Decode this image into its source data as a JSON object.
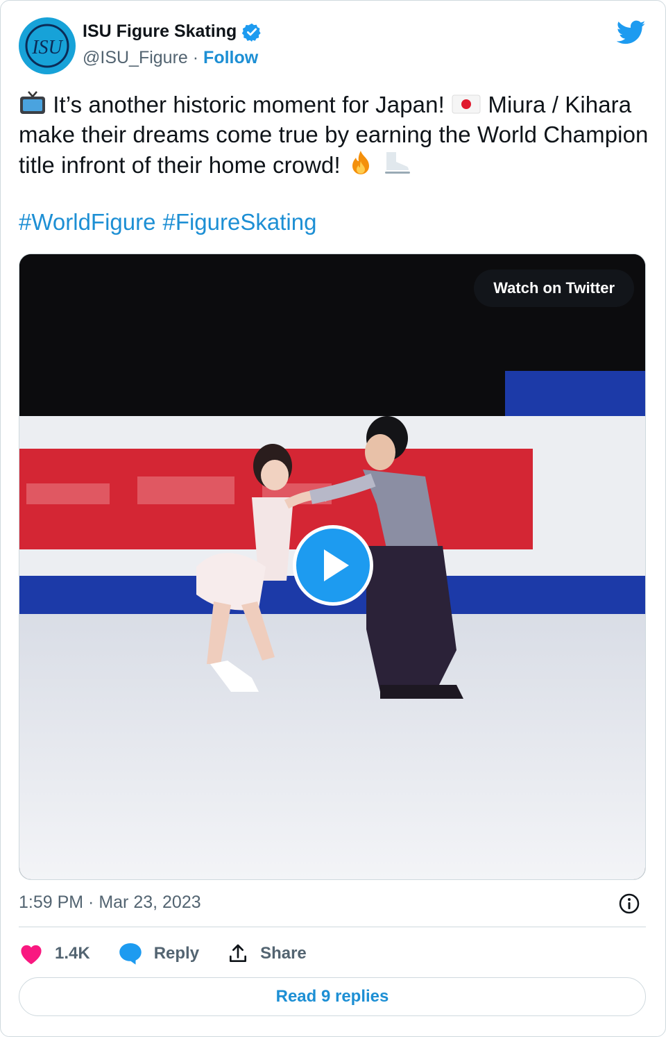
{
  "author": {
    "display_name": "ISU Figure Skating",
    "handle": "@ISU_Figure",
    "separator": " · ",
    "follow_label": "Follow",
    "avatar_logo_text": "ISU",
    "verified_icon": "verified-badge-icon",
    "platform_icon": "twitter-bird-icon"
  },
  "tweet": {
    "text_part1": "It’s another historic moment for Japan!",
    "text_part2": "Miura / Kihara make their dreams come true by earning the World Champion title infront of their home crowd!",
    "hashtags": [
      "#WorldFigure",
      "#FigureSkating"
    ]
  },
  "media": {
    "watch_label": "Watch on Twitter",
    "play_icon": "play-icon"
  },
  "meta": {
    "timestamp": "1:59 PM · Mar 23, 2023",
    "info_icon": "info-icon"
  },
  "actions": {
    "likes": "1.4K",
    "reply_label": "Reply",
    "share_label": "Share"
  },
  "read_replies_label": "Read 9 replies",
  "colors": {
    "accent": "#1d8fd4",
    "like": "#f91880",
    "text": "#0f1419",
    "muted": "#536471"
  }
}
